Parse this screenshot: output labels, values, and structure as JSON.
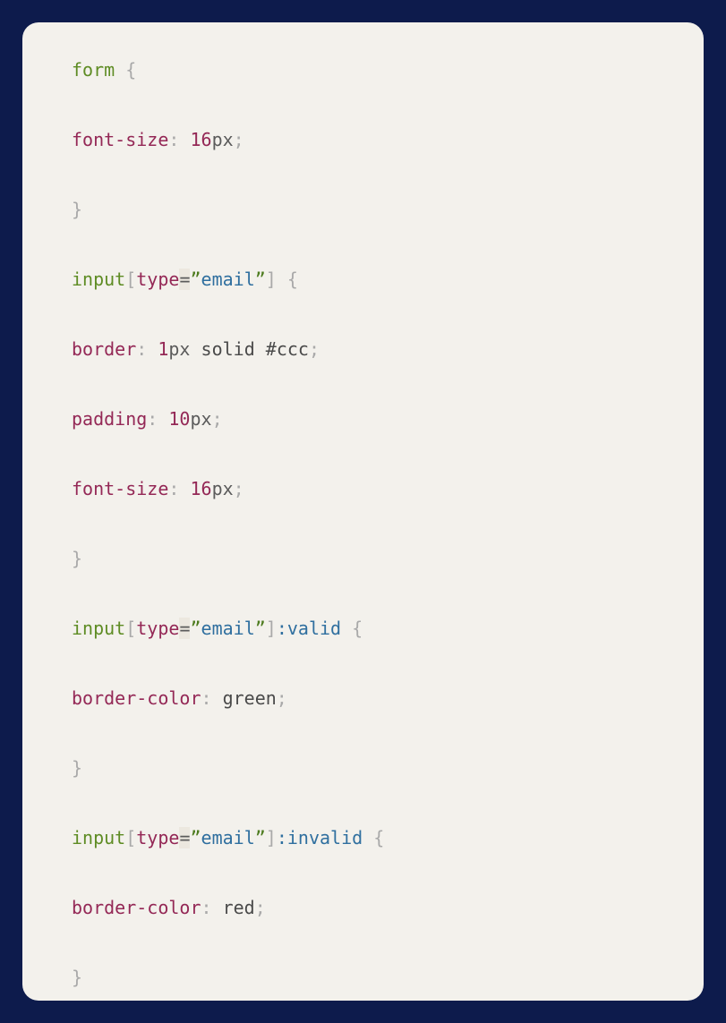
{
  "code": {
    "lines": [
      [
        {
          "cls": "tag",
          "text": "form"
        },
        {
          "cls": "plain",
          "text": " "
        },
        {
          "cls": "punct",
          "text": "{"
        }
      ],
      [
        {
          "cls": "prop",
          "text": "font-size"
        },
        {
          "cls": "punct",
          "text": ":"
        },
        {
          "cls": "plain",
          "text": " "
        },
        {
          "cls": "num",
          "text": "16"
        },
        {
          "cls": "unit",
          "text": "px"
        },
        {
          "cls": "punct",
          "text": ";"
        }
      ],
      [
        {
          "cls": "punct",
          "text": "}"
        }
      ],
      [
        {
          "cls": "tag",
          "text": "input"
        },
        {
          "cls": "attr-open",
          "text": "["
        },
        {
          "cls": "attr-name",
          "text": "type"
        },
        {
          "cls": "attr-eq",
          "text": "="
        },
        {
          "cls": "attr-quote",
          "text": "”"
        },
        {
          "cls": "attr-val",
          "text": "email"
        },
        {
          "cls": "attr-quote",
          "text": "”"
        },
        {
          "cls": "attr-open",
          "text": "]"
        },
        {
          "cls": "plain",
          "text": " "
        },
        {
          "cls": "punct",
          "text": "{"
        }
      ],
      [
        {
          "cls": "prop",
          "text": "border"
        },
        {
          "cls": "punct",
          "text": ":"
        },
        {
          "cls": "plain",
          "text": " "
        },
        {
          "cls": "num",
          "text": "1"
        },
        {
          "cls": "unit",
          "text": "px"
        },
        {
          "cls": "plain",
          "text": " solid #ccc"
        },
        {
          "cls": "punct",
          "text": ";"
        }
      ],
      [
        {
          "cls": "prop",
          "text": "padding"
        },
        {
          "cls": "punct",
          "text": ":"
        },
        {
          "cls": "plain",
          "text": " "
        },
        {
          "cls": "num",
          "text": "10"
        },
        {
          "cls": "unit",
          "text": "px"
        },
        {
          "cls": "punct",
          "text": ";"
        }
      ],
      [
        {
          "cls": "prop",
          "text": "font-size"
        },
        {
          "cls": "punct",
          "text": ":"
        },
        {
          "cls": "plain",
          "text": " "
        },
        {
          "cls": "num",
          "text": "16"
        },
        {
          "cls": "unit",
          "text": "px"
        },
        {
          "cls": "punct",
          "text": ";"
        }
      ],
      [
        {
          "cls": "punct",
          "text": "}"
        }
      ],
      [
        {
          "cls": "tag",
          "text": "input"
        },
        {
          "cls": "attr-open",
          "text": "["
        },
        {
          "cls": "attr-name",
          "text": "type"
        },
        {
          "cls": "attr-eq",
          "text": "="
        },
        {
          "cls": "attr-quote",
          "text": "”"
        },
        {
          "cls": "attr-val",
          "text": "email"
        },
        {
          "cls": "attr-quote",
          "text": "”"
        },
        {
          "cls": "attr-open",
          "text": "]"
        },
        {
          "cls": "pseudo",
          "text": ":valid"
        },
        {
          "cls": "plain",
          "text": " "
        },
        {
          "cls": "punct",
          "text": "{"
        }
      ],
      [
        {
          "cls": "prop",
          "text": "border-color"
        },
        {
          "cls": "punct",
          "text": ":"
        },
        {
          "cls": "plain",
          "text": " green"
        },
        {
          "cls": "punct",
          "text": ";"
        }
      ],
      [
        {
          "cls": "punct",
          "text": "}"
        }
      ],
      [
        {
          "cls": "tag",
          "text": "input"
        },
        {
          "cls": "attr-open",
          "text": "["
        },
        {
          "cls": "attr-name",
          "text": "type"
        },
        {
          "cls": "attr-eq",
          "text": "="
        },
        {
          "cls": "attr-quote",
          "text": "”"
        },
        {
          "cls": "attr-val",
          "text": "email"
        },
        {
          "cls": "attr-quote",
          "text": "”"
        },
        {
          "cls": "attr-open",
          "text": "]"
        },
        {
          "cls": "pseudo",
          "text": ":invalid"
        },
        {
          "cls": "plain",
          "text": " "
        },
        {
          "cls": "punct",
          "text": "{"
        }
      ],
      [
        {
          "cls": "prop",
          "text": "border-color"
        },
        {
          "cls": "punct",
          "text": ":"
        },
        {
          "cls": "plain",
          "text": " red"
        },
        {
          "cls": "punct",
          "text": ";"
        }
      ],
      [
        {
          "cls": "punct",
          "text": "}"
        }
      ]
    ]
  }
}
